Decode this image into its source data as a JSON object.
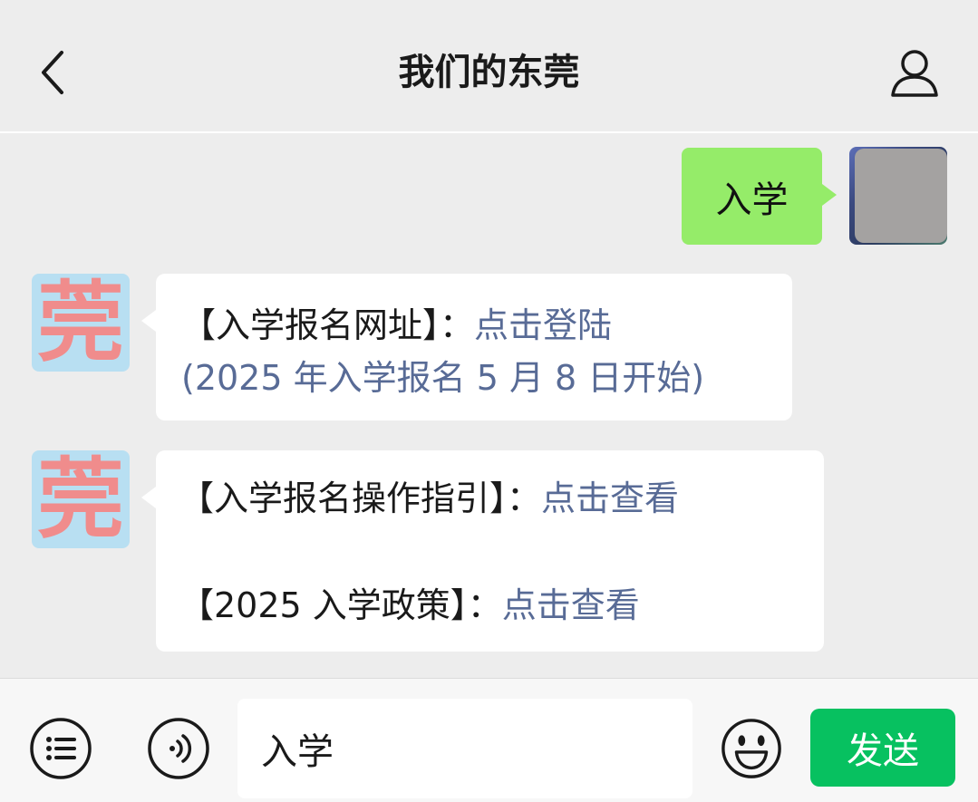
{
  "header": {
    "title": "我们的东莞"
  },
  "chat": {
    "outgoing": {
      "text": "入学"
    },
    "bot_avatar_glyph": "莞",
    "msg1": {
      "line1_text": "【入学报名网址】：",
      "line1_link": "点击登陆",
      "line2_link": "(2025 年入学报名 5 月 8 日开始)"
    },
    "msg2": {
      "line1_text": "【入学报名操作指引】：",
      "line1_link": "点击查看",
      "line2_text": "【2025 入学政策】：",
      "line2_link": "点击查看"
    }
  },
  "input": {
    "value": "入学"
  },
  "send": {
    "label": "发送"
  },
  "colors": {
    "background": "#ededed",
    "outgoing_bubble": "#95ec69",
    "link": "#586b96",
    "send_button": "#07c160",
    "bot_avatar_bg": "#b8dff2",
    "bot_avatar_glyph": "#f08c8c"
  },
  "icons": {
    "back": "chevron-left-icon",
    "profile": "person-icon",
    "menu": "list-icon",
    "voice": "voice-icon",
    "emoji": "smiley-icon"
  }
}
